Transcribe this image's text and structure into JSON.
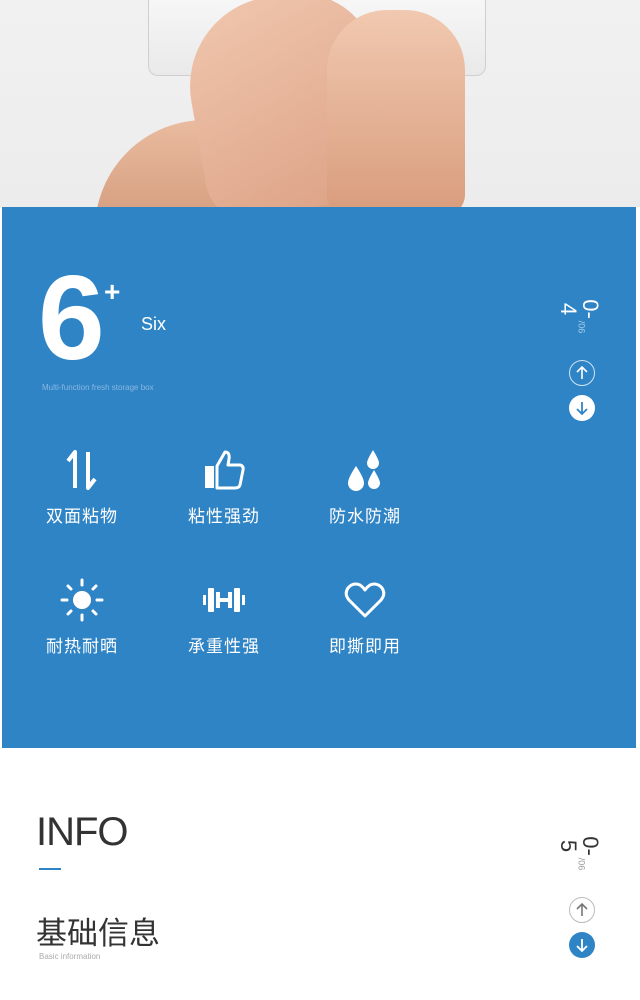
{
  "hero": {
    "number": "6",
    "superscript": "+",
    "word": "Six",
    "subtitle": "Multi-function fresh storage box"
  },
  "features": [
    {
      "icon": "arrows-up-down-icon",
      "label": "双面粘物"
    },
    {
      "icon": "thumbs-up-icon",
      "label": "粘性强劲"
    },
    {
      "icon": "water-drops-icon",
      "label": "防水防潮"
    },
    {
      "icon": "sun-icon",
      "label": "耐热耐晒"
    },
    {
      "icon": "dumbbell-icon",
      "label": "承重性强"
    },
    {
      "icon": "heart-icon",
      "label": "即撕即用"
    }
  ],
  "pager_blue": {
    "current": "0-4",
    "total": "/06"
  },
  "info": {
    "title": "INFO",
    "cn_title": "基础信息",
    "cn_subtitle": "Basic information"
  },
  "pager_white": {
    "current": "0-5",
    "total": "/06"
  },
  "colors": {
    "accent": "#2f84c6",
    "white": "#ffffff"
  }
}
